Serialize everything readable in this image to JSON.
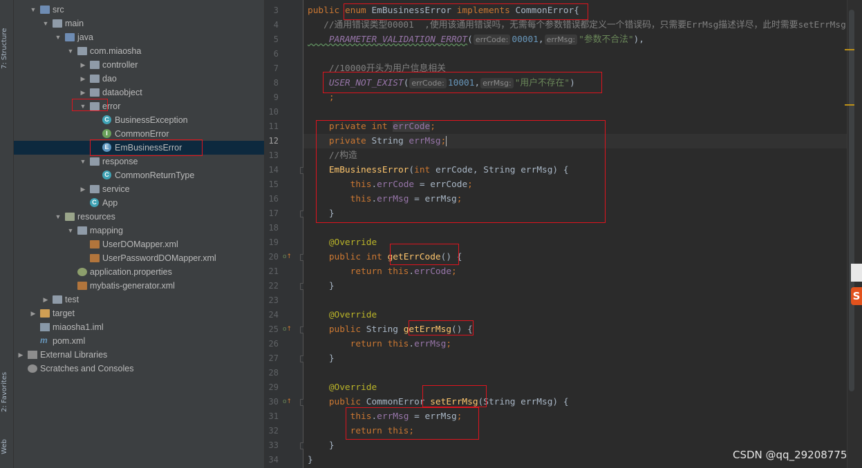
{
  "side_tabs": {
    "structure": "7: Structure",
    "favorites": "2: Favorites",
    "web": "Web"
  },
  "project_tree": [
    {
      "label": "src",
      "indent": 1,
      "arrow": "down",
      "icon": "folder-src"
    },
    {
      "label": "main",
      "indent": 2,
      "arrow": "down",
      "icon": "folder"
    },
    {
      "label": "java",
      "indent": 3,
      "arrow": "down",
      "icon": "folder-src"
    },
    {
      "label": "com.miaosha",
      "indent": 4,
      "arrow": "down",
      "icon": "package"
    },
    {
      "label": "controller",
      "indent": 5,
      "arrow": "right",
      "icon": "package"
    },
    {
      "label": "dao",
      "indent": 5,
      "arrow": "right",
      "icon": "package"
    },
    {
      "label": "dataobject",
      "indent": 5,
      "arrow": "right",
      "icon": "package"
    },
    {
      "label": "error",
      "indent": 5,
      "arrow": "down",
      "icon": "package"
    },
    {
      "label": "BusinessException",
      "indent": 6,
      "arrow": "",
      "icon": "class"
    },
    {
      "label": "CommonError",
      "indent": 6,
      "arrow": "",
      "icon": "interface"
    },
    {
      "label": "EmBusinessError",
      "indent": 6,
      "arrow": "",
      "icon": "enum",
      "selected": true
    },
    {
      "label": "response",
      "indent": 5,
      "arrow": "down",
      "icon": "package"
    },
    {
      "label": "CommonReturnType",
      "indent": 6,
      "arrow": "",
      "icon": "class"
    },
    {
      "label": "service",
      "indent": 5,
      "arrow": "right",
      "icon": "package"
    },
    {
      "label": "App",
      "indent": 5,
      "arrow": "",
      "icon": "class"
    },
    {
      "label": "resources",
      "indent": 3,
      "arrow": "down",
      "icon": "folder-res"
    },
    {
      "label": "mapping",
      "indent": 4,
      "arrow": "down",
      "icon": "folder"
    },
    {
      "label": "UserDOMapper.xml",
      "indent": 5,
      "arrow": "",
      "icon": "xml"
    },
    {
      "label": "UserPasswordDOMapper.xml",
      "indent": 5,
      "arrow": "",
      "icon": "xml"
    },
    {
      "label": "application.properties",
      "indent": 4,
      "arrow": "",
      "icon": "props"
    },
    {
      "label": "mybatis-generator.xml",
      "indent": 4,
      "arrow": "",
      "icon": "xml"
    },
    {
      "label": "test",
      "indent": 2,
      "arrow": "right",
      "icon": "folder"
    },
    {
      "label": "target",
      "indent": 1,
      "arrow": "right",
      "icon": "folder-target"
    },
    {
      "label": "miaosha1.iml",
      "indent": 1,
      "arrow": "",
      "icon": "iml"
    },
    {
      "label": "pom.xml",
      "indent": 1,
      "arrow": "",
      "icon": "maven"
    },
    {
      "label": "External Libraries",
      "indent": 0,
      "arrow": "right",
      "icon": "libs"
    },
    {
      "label": "Scratches and Consoles",
      "indent": 0,
      "arrow": "",
      "icon": "scratch"
    }
  ],
  "editor": {
    "current_line": 12,
    "line_numbers": [
      "3",
      "4",
      "5",
      "6",
      "7",
      "8",
      "9",
      "10",
      "11",
      "12",
      "13",
      "14",
      "15",
      "16",
      "17",
      "18",
      "19",
      "20",
      "21",
      "22",
      "23",
      "24",
      "25",
      "26",
      "27",
      "28",
      "29",
      "30",
      "31",
      "32",
      "33",
      "34"
    ],
    "lines": [
      [
        [
          "kw",
          "public "
        ],
        [
          "kw",
          "enum "
        ],
        [
          "",
          "EmBusinessError "
        ],
        [
          "kw",
          "implements "
        ],
        [
          "",
          "CommonError{"
        ]
      ],
      [
        [
          "cm",
          "   //通用错误类型00001  ,使用该通用错误吗，无需每个参数错误都定义一个错误码，只需要ErrMsg描述详尽，此时需要setErrMsg"
        ]
      ],
      [
        [
          "enumc",
          "    PARAMETER_VALIDATION_ERROT"
        ],
        [
          "",
          "("
        ],
        [
          "hint",
          "errCode:"
        ],
        [
          "num",
          "00001"
        ],
        [
          "",
          ","
        ],
        [
          "hint",
          "errMsg:"
        ],
        [
          "str",
          "\"参数不合法\""
        ],
        [
          "",
          "),"
        ]
      ],
      [
        [
          "",
          ""
        ]
      ],
      [
        [
          "cm",
          "    //10000开头为用户信息相关"
        ]
      ],
      [
        [
          "enumc",
          "    USER_NOT_EXIST"
        ],
        [
          "",
          "("
        ],
        [
          "hint",
          "errCode:"
        ],
        [
          "num",
          "10001"
        ],
        [
          "",
          ","
        ],
        [
          "hint",
          "errMsg:"
        ],
        [
          "str",
          "\"用户不存在\""
        ],
        [
          "",
          ")"
        ]
      ],
      [
        [
          "kw",
          "    ;"
        ]
      ],
      [
        [
          "",
          ""
        ]
      ],
      [
        [
          "kw",
          "    private "
        ],
        [
          "kw",
          "int "
        ],
        [
          "fldhl",
          "errCode"
        ],
        [
          "kw",
          ";"
        ]
      ],
      [
        [
          "kw",
          "    private "
        ],
        [
          "",
          "String "
        ],
        [
          "fld",
          "errMsg"
        ],
        [
          "kw",
          ";"
        ],
        [
          "cursor",
          ""
        ]
      ],
      [
        [
          "cm",
          "    //构造"
        ]
      ],
      [
        [
          "mth",
          "    EmBusinessError"
        ],
        [
          "",
          "("
        ],
        [
          "kw",
          "int "
        ],
        [
          "",
          "errCode, String errMsg) {"
        ]
      ],
      [
        [
          "kw",
          "        this"
        ],
        [
          "",
          ".",
          "n"
        ],
        [
          "fld",
          "errCode"
        ],
        [
          "",
          " = errCode"
        ],
        [
          "kw",
          ";"
        ]
      ],
      [
        [
          "kw",
          "        this"
        ],
        [
          "",
          ".",
          "n"
        ],
        [
          "fld",
          "errMsg"
        ],
        [
          "",
          " = errMsg"
        ],
        [
          "kw",
          ";"
        ]
      ],
      [
        [
          "",
          "    }"
        ]
      ],
      [
        [
          "",
          ""
        ]
      ],
      [
        [
          "ann",
          "    @Override"
        ]
      ],
      [
        [
          "kw",
          "    public "
        ],
        [
          "kw",
          "int "
        ],
        [
          "mth",
          "getErrCode"
        ],
        [
          "",
          "() {"
        ]
      ],
      [
        [
          "kw",
          "        return this"
        ],
        [
          "",
          "."
        ],
        [
          "fld",
          "errCode"
        ],
        [
          "kw",
          ";"
        ]
      ],
      [
        [
          "",
          "    }"
        ]
      ],
      [
        [
          "",
          ""
        ]
      ],
      [
        [
          "ann",
          "    @Override"
        ]
      ],
      [
        [
          "kw",
          "    public "
        ],
        [
          "",
          "String "
        ],
        [
          "mth",
          "getErrMsg"
        ],
        [
          "",
          "() {"
        ]
      ],
      [
        [
          "kw",
          "        return this"
        ],
        [
          "",
          "."
        ],
        [
          "fld",
          "errMsg"
        ],
        [
          "kw",
          ";"
        ]
      ],
      [
        [
          "",
          "    }"
        ]
      ],
      [
        [
          "",
          ""
        ]
      ],
      [
        [
          "ann",
          "    @Override"
        ]
      ],
      [
        [
          "kw",
          "    public "
        ],
        [
          "",
          "CommonError "
        ],
        [
          "mth",
          "setErrMsg"
        ],
        [
          "",
          "(String errMsg) {"
        ]
      ],
      [
        [
          "kw",
          "        this"
        ],
        [
          "",
          "."
        ],
        [
          "fld",
          "errMsg"
        ],
        [
          "",
          " = errMsg"
        ],
        [
          "kw",
          ";"
        ]
      ],
      [
        [
          "kw",
          "        return this;"
        ]
      ],
      [
        [
          "",
          "    }"
        ]
      ],
      [
        [
          "",
          "}"
        ]
      ]
    ]
  },
  "watermark": "CSDN @qq_29208775",
  "float_logo_glyph": "S"
}
